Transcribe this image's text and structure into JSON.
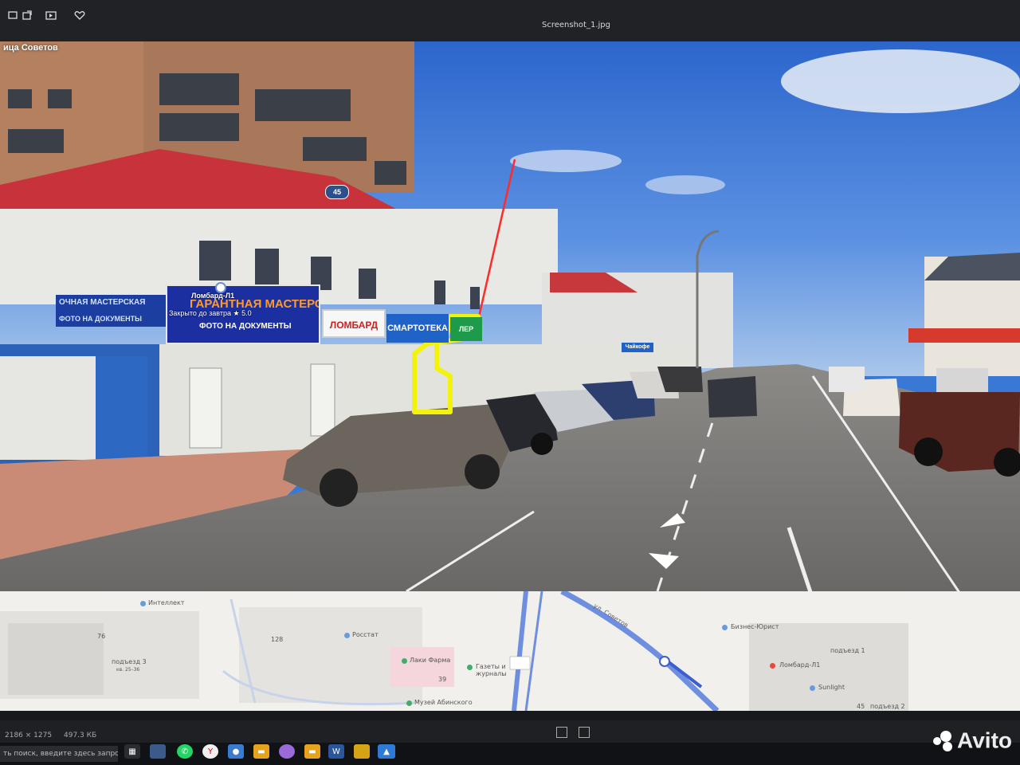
{
  "window": {
    "title": "Screenshot_1.jpg"
  },
  "street_view": {
    "street_overlay_label": "ица Советов",
    "house_badge": "45",
    "signs": {
      "workshop_banner": "ГАРАНТНАЯ МАСТЕРСКАЯ",
      "workshop_sub": "ФОТО НА ДОКУМЕНТЫ",
      "workshop_left": "ОЧНАЯ МАСТЕРСКАЯ",
      "workshop_left_sub": "ФОТО НА ДОКУМЕНТЫ",
      "lombard_sign": "ЛОМБАРД",
      "smartoteka_sign": "СМАРТОТЕКА",
      "green_sign": "ЛЕР",
      "cafe_sign": "Чайкофе"
    },
    "place_card": {
      "name": "Ломбард-Л1",
      "status": "Закрыто до завтра",
      "rating": "★ 5.0"
    },
    "colors": {
      "highlight": "#f2f20a",
      "annotation_line": "#ff2a2a"
    }
  },
  "map": {
    "labels": {
      "intellekt": "Интеллект",
      "rosstat": "Росстат",
      "laki_farma": "Лаки Фарма",
      "gazety": "Газеты и журналы",
      "muzey": "Музей Абинского",
      "street": "ул. Советов",
      "biznes_yurist": "Бизнес-Юрист",
      "lombard": "Ломбард-Л1",
      "sunlight": "Sunlight",
      "podezd1": "подъезд 1",
      "podezd2": "подъезд 2",
      "podezd3": "подъезд 3",
      "kv": "кв. 25–36"
    },
    "house_numbers": {
      "n76": "76",
      "n128": "128",
      "n39": "39",
      "n45": "45"
    }
  },
  "status": {
    "dimensions": "2186 × 1275",
    "filesize": "497.3 КБ"
  },
  "taskbar": {
    "search_placeholder": "ть поиск, введите здесь запрос"
  },
  "watermark": "Avito"
}
